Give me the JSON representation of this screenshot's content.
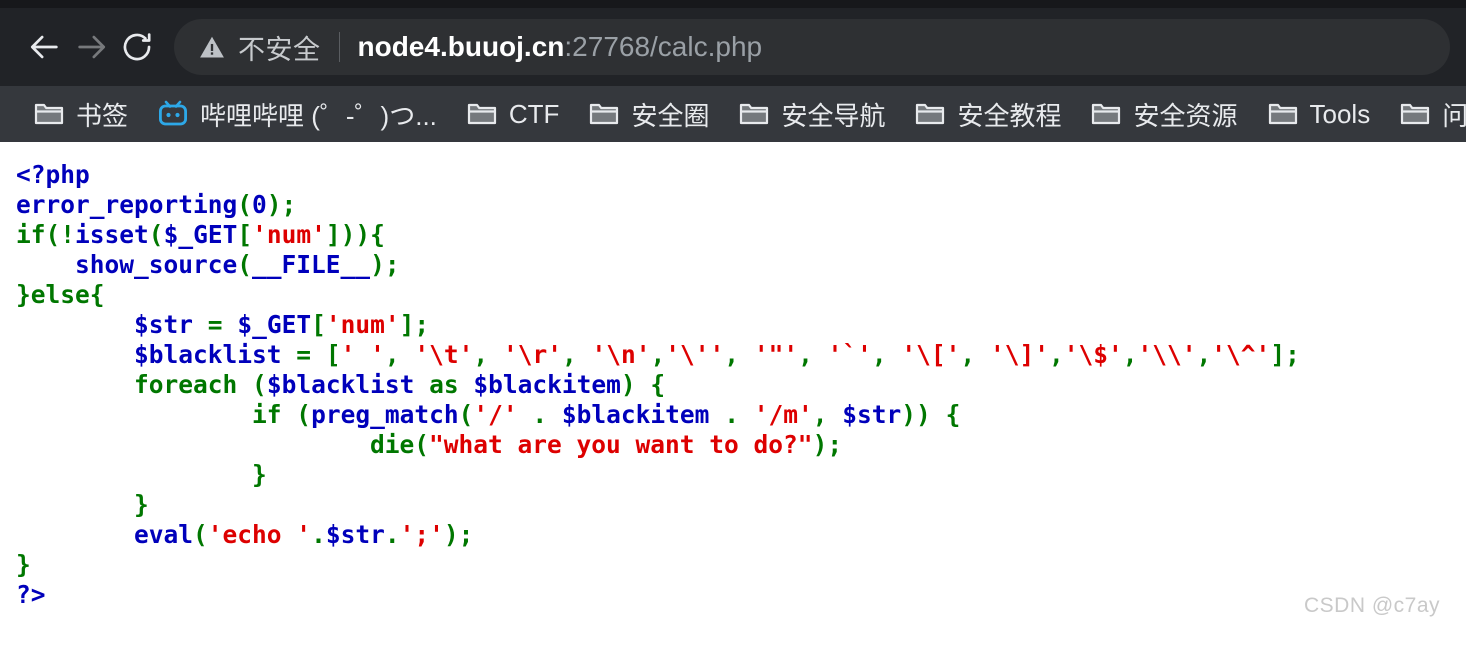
{
  "browser": {
    "nav": {
      "back_icon": "arrow-left-icon",
      "forward_icon": "arrow-right-icon",
      "reload_icon": "reload-icon"
    },
    "omnibox": {
      "security_icon": "warning-triangle-icon",
      "security_label": "不安全",
      "url_host": "node4.buuoj.cn",
      "url_rest": ":27768/calc.php",
      "full_url": "node4.buuoj.cn:27768/calc.php"
    },
    "bookmarks": [
      {
        "icon": "folder-icon",
        "label": "书签"
      },
      {
        "icon": "bilibili-icon",
        "label": "哔哩哔哩 (゜-゜)つ..."
      },
      {
        "icon": "folder-icon",
        "label": "CTF"
      },
      {
        "icon": "folder-icon",
        "label": "安全圈"
      },
      {
        "icon": "folder-icon",
        "label": "安全导航"
      },
      {
        "icon": "folder-icon",
        "label": "安全教程"
      },
      {
        "icon": "folder-icon",
        "label": "安全资源"
      },
      {
        "icon": "folder-icon",
        "label": "Tools"
      },
      {
        "icon": "folder-icon",
        "label": "问"
      }
    ]
  },
  "colors": {
    "toolbar_bg": "#212327",
    "bookmarks_bg": "#35383d",
    "omnibox_bg": "#2e3033",
    "page_bg": "#ffffff",
    "php_blue": "#0000BB",
    "php_green": "#007700",
    "php_red": "#DD0000",
    "bilibili_blue": "#2da8e8"
  },
  "source": {
    "language": "php",
    "filename": "calc.php",
    "lines": [
      "<?php",
      "error_reporting(0);",
      "if(!isset($_GET['num'])){",
      "    show_source(__FILE__);",
      "}else{",
      "        $str = $_GET['num'];",
      "        $blacklist = [' ', '\\t', '\\r', '\\n','\\'', '\"', '`', '\\[', '\\]','\\$','\\\\','\\^'];",
      "        foreach ($blacklist as $blackitem) {",
      "                if (preg_match('/' . $blackitem . '/m', $str)) {",
      "                        die(\"what are you want to do?\");",
      "                }",
      "        }",
      "        eval('echo '.$str.';');",
      "}",
      "?>"
    ]
  },
  "watermark": {
    "text": "CSDN @c7ay"
  }
}
